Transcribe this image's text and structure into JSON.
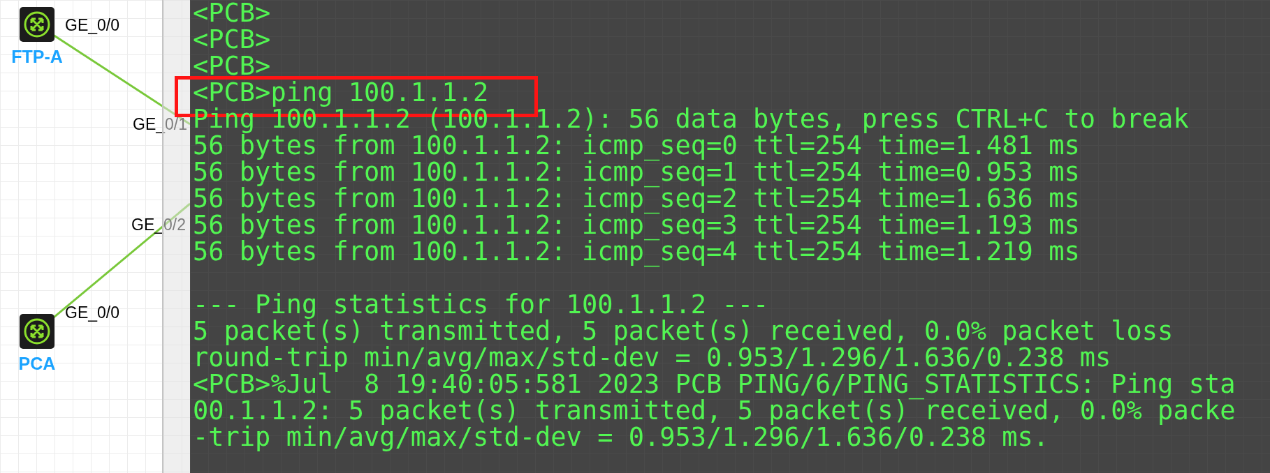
{
  "topology": {
    "nodes": [
      {
        "label": "FTP-A"
      },
      {
        "label": "PCA"
      }
    ],
    "port_labels": [
      {
        "text": "GE_0/0"
      },
      {
        "text": "GE_0/1"
      },
      {
        "text": "GE_0/2"
      },
      {
        "text": "GE_0/0"
      }
    ]
  },
  "terminal": {
    "blocks": [
      [
        {
          "text": "<PCB>",
          "highlighted": false
        },
        {
          "text": "<PCB>",
          "highlighted": false
        },
        {
          "text": "<PCB>",
          "highlighted": false
        },
        {
          "text": "<PCB>ping 100.1.1.2",
          "highlighted": true
        },
        {
          "text": "Ping 100.1.1.2 (100.1.1.2): 56 data bytes, press CTRL+C to break",
          "highlighted": false
        },
        {
          "text": "56 bytes from 100.1.1.2: icmp_seq=0 ttl=254 time=1.481 ms",
          "highlighted": false
        },
        {
          "text": "56 bytes from 100.1.1.2: icmp_seq=1 ttl=254 time=0.953 ms",
          "highlighted": false
        },
        {
          "text": "56 bytes from 100.1.1.2: icmp_seq=2 ttl=254 time=1.636 ms",
          "highlighted": false
        },
        {
          "text": "56 bytes from 100.1.1.2: icmp_seq=3 ttl=254 time=1.193 ms",
          "highlighted": false
        },
        {
          "text": "56 bytes from 100.1.1.2: icmp_seq=4 ttl=254 time=1.219 ms",
          "highlighted": false
        }
      ],
      [
        {
          "text": "--- Ping statistics for 100.1.1.2 ---",
          "highlighted": false
        },
        {
          "text": "5 packet(s) transmitted, 5 packet(s) received, 0.0% packet loss",
          "highlighted": false
        },
        {
          "text": "round-trip min/avg/max/std-dev = 0.953/1.296/1.636/0.238 ms",
          "highlighted": false
        },
        {
          "text": "<PCB>%Jul  8 19:40:05:581 2023 PCB PING/6/PING_STATISTICS: Ping sta",
          "highlighted": false
        },
        {
          "text": "00.1.1.2: 5 packet(s) transmitted, 5 packet(s) received, 0.0% packe",
          "highlighted": false
        },
        {
          "text": "-trip min/avg/max/std-dev = 0.953/1.296/1.636/0.238 ms.",
          "highlighted": false
        }
      ]
    ]
  }
}
